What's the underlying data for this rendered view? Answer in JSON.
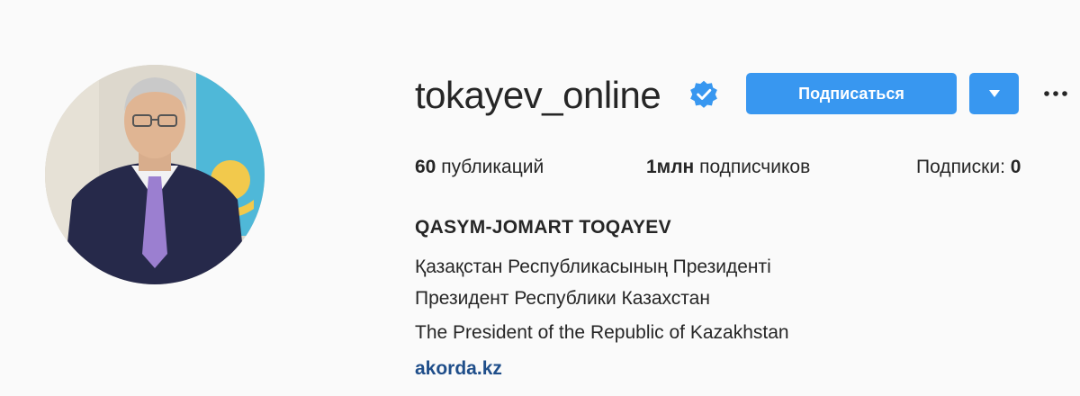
{
  "profile": {
    "username": "tokayev_online",
    "verified": true,
    "avatar_alt": "profile photo"
  },
  "actions": {
    "follow_label": "Подписаться",
    "dropdown_icon": "caret-down-icon",
    "more_icon": "more-options-icon"
  },
  "stats": {
    "posts_count": "60",
    "posts_label": "публикаций",
    "followers_count": "1млн",
    "followers_label": "подписчиков",
    "following_label": "Подписки:",
    "following_count": "0"
  },
  "bio": {
    "full_name": "QASYM-JOMART TOQAYEV",
    "line1": "Қазақстан Республикасының Президенті",
    "line2": "Президент Республики Казахстан",
    "line3": "The President of the Republic of Kazakhstan",
    "link": "akorda.kz"
  },
  "colors": {
    "accent": "#3897f0",
    "link": "#1f4e8a",
    "text": "#262626",
    "background": "#fafafa"
  }
}
